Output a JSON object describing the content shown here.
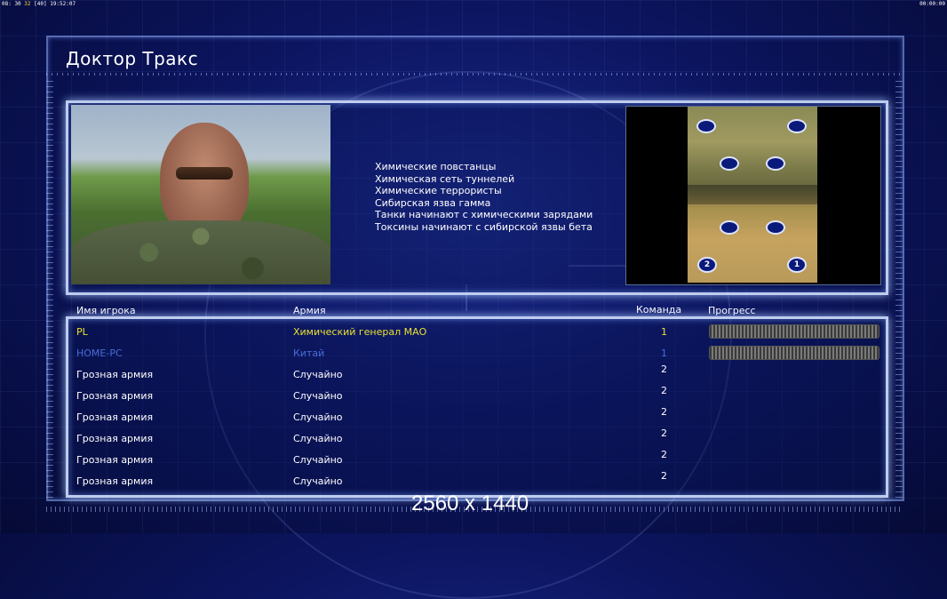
{
  "statusbar": {
    "left_prefix": "08: 30 ",
    "left_highlight": "32",
    "left_suffix": " [40]  19:52:07",
    "right": "00:00:00"
  },
  "title": "Доктор Тракс",
  "description": [
    "Химические повстанцы",
    "Химическая сеть туннелей",
    "Химические террористы",
    "Сибирская язва гамма",
    "Танки начинают с химическими зарядами",
    "Токсины начинают с сибирской язвы бета"
  ],
  "minimap": {
    "start_labels": [
      "2",
      "1"
    ]
  },
  "table": {
    "headers": {
      "name": "Имя игрока",
      "army": "Армия",
      "team": "Команда",
      "progress": "Прогресс"
    },
    "rows": [
      {
        "name": "PL",
        "army": "Химический генерал МАО",
        "team": "1",
        "color": "#e8e030",
        "has_progress": true
      },
      {
        "name": "HOME-PC",
        "army": "Китай",
        "team": "1",
        "color": "#4a6cd8",
        "has_progress": true
      },
      {
        "name": "Грозная армия",
        "army": "Случайно",
        "team": "2",
        "color": "#ffffff",
        "has_progress": false
      },
      {
        "name": "Грозная армия",
        "army": "Случайно",
        "team": "2",
        "color": "#ffffff",
        "has_progress": false
      },
      {
        "name": "Грозная армия",
        "army": "Случайно",
        "team": "2",
        "color": "#ffffff",
        "has_progress": false
      },
      {
        "name": "Грозная армия",
        "army": "Случайно",
        "team": "2",
        "color": "#ffffff",
        "has_progress": false
      },
      {
        "name": "Грозная армия",
        "army": "Случайно",
        "team": "2",
        "color": "#ffffff",
        "has_progress": false
      },
      {
        "name": "Грозная армия",
        "army": "Случайно",
        "team": "2",
        "color": "#ffffff",
        "has_progress": false
      }
    ]
  },
  "overlay_resolution": "2560 x 1440"
}
